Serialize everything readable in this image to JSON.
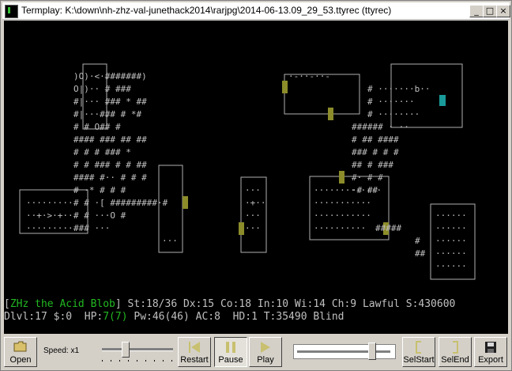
{
  "window": {
    "title": "Termplay: K:\\down\\nh-zhz-val-junethack2014\\rarjpg\\2014-06-13.09_29_53.ttyrec (ttyrec)",
    "controls": [
      "_",
      "□",
      "×"
    ]
  },
  "status": {
    "line1_open": "[",
    "name": "ZHz the Acid Blob",
    "line1_rest": "] St:18/36 Dx:15 Co:18 In:10 Wi:14 Ch:9 Lawful S:430600",
    "line2_a": "Dlvl:17 $:0  HP:",
    "hp": "7(7)",
    "line2_b": " Pw:46(46) AC:8  HD:1 T:35490 Blind"
  },
  "toolbar": {
    "open_label": "Open",
    "speed_label": "Speed: x1",
    "restart_label": "Restart",
    "pause_label": "Pause",
    "play_label": "Play",
    "selstart_label": "SelStart",
    "selend_label": "SelEnd",
    "export_label": "Export",
    "speed_level": 0.3,
    "progress_level": 0.77
  },
  "colors": {
    "terminal_bg": "#000000",
    "terminal_fg": "#c0c0c0",
    "green": "#22b822",
    "door": "#8c8c2a",
    "player": "#1a9a9a"
  }
}
